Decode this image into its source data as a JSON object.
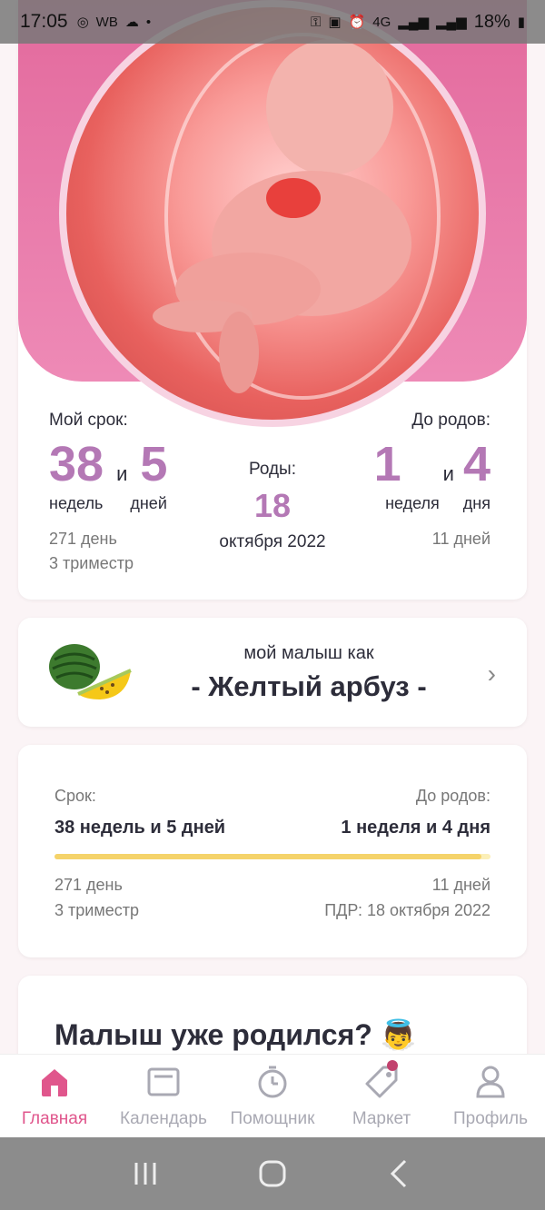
{
  "status_bar": {
    "time": "17:05",
    "left_icons": [
      "instagram-icon",
      "wb-icon",
      "cloud-icon",
      "dot-icon"
    ],
    "network": "4G",
    "battery": "18%"
  },
  "term": {
    "my_term_label": "Мой срок:",
    "weeks": "38",
    "and": "и",
    "days": "5",
    "weeks_unit": "недель",
    "days_unit": "дней",
    "day_count": "271 день",
    "trimester": "3 триместр",
    "birth_label": "Роды:",
    "birth_day": "18",
    "birth_month_year": "октября 2022",
    "until_label": "До родов:",
    "until_weeks": "1",
    "until_and": "и",
    "until_days": "4",
    "until_weeks_unit": "неделя",
    "until_days_unit": "дня",
    "until_day_count": "11 дней"
  },
  "fruit": {
    "label": "мой малыш как",
    "name": "- Желтый арбуз -"
  },
  "progress": {
    "term_label": "Срок:",
    "term_value": "38 недель и 5 дней",
    "until_label": "До родов:",
    "until_value": "1 неделя и 4 дня",
    "fill_fraction": 0.98,
    "day_count": "271 день",
    "until_days": "11 дней",
    "trimester": "3 триместр",
    "pdr": "ПДР: 18 октября 2022",
    "bar_colors": {
      "fill": "#f5d36a",
      "track": "#fbefb8"
    }
  },
  "born": {
    "title": "Малыш уже родился?",
    "emoji": "👼"
  },
  "nav": [
    {
      "label": "Главная",
      "icon": "home-icon",
      "active": true
    },
    {
      "label": "Календарь",
      "icon": "calendar-icon",
      "active": false
    },
    {
      "label": "Помощник",
      "icon": "timer-icon",
      "active": false
    },
    {
      "label": "Маркет",
      "icon": "tag-icon",
      "active": false,
      "badge": true
    },
    {
      "label": "Профиль",
      "icon": "user-icon",
      "active": false
    }
  ],
  "colors": {
    "accent": "#e0568c",
    "number_purple": "#b478b5",
    "banner_pink": "#e36a9d"
  }
}
